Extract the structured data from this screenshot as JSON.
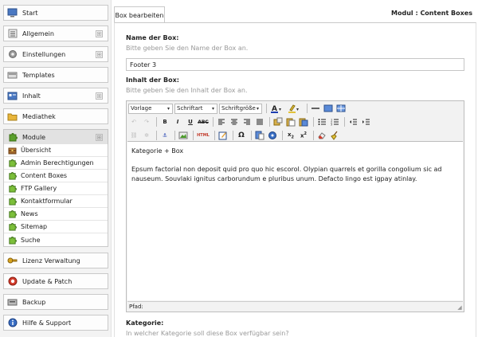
{
  "sidebar": {
    "items": [
      {
        "label": "Start",
        "icon": "monitor-icon",
        "expandable": false
      },
      {
        "label": "Allgemein",
        "icon": "list-icon",
        "expandable": true
      },
      {
        "label": "Einstellungen",
        "icon": "gear-icon",
        "expandable": true
      },
      {
        "label": "Templates",
        "icon": "template-icon",
        "expandable": false
      },
      {
        "label": "Inhalt",
        "icon": "content-icon",
        "expandable": true
      },
      {
        "label": "Mediathek",
        "icon": "folder-icon",
        "expandable": false
      },
      {
        "label": "Module",
        "icon": "puzzle-icon",
        "expandable": true
      },
      {
        "label": "Lizenz Verwaltung",
        "icon": "key-icon",
        "expandable": false
      },
      {
        "label": "Update & Patch",
        "icon": "update-icon",
        "expandable": false
      },
      {
        "label": "Backup",
        "icon": "backup-icon",
        "expandable": false
      },
      {
        "label": "Hilfe & Support",
        "icon": "help-icon",
        "expandable": false
      }
    ],
    "expand_symbol": "⊞",
    "module_sub": [
      {
        "label": "Übersicht",
        "icon": "chest-icon"
      },
      {
        "label": "Admin Berechtigungen",
        "icon": "puzzle-icon"
      },
      {
        "label": "Content Boxes",
        "icon": "puzzle-icon"
      },
      {
        "label": "FTP Gallery",
        "icon": "puzzle-icon"
      },
      {
        "label": "Kontaktformular",
        "icon": "puzzle-icon"
      },
      {
        "label": "News",
        "icon": "puzzle-icon"
      },
      {
        "label": "Sitemap",
        "icon": "puzzle-icon"
      },
      {
        "label": "Suche",
        "icon": "puzzle-icon"
      }
    ]
  },
  "main": {
    "tab_label": "Box bearbeiten",
    "module_title": "Modul : Content Boxes",
    "name_label": "Name der Box:",
    "name_hint": "Bitte geben Sie den Name der Box an.",
    "name_value": "Footer 3",
    "content_label": "Inhalt der Box:",
    "content_hint": "Bitte geben Sie den Inhalt der Box an.",
    "category_label": "Kategorie:",
    "category_hint": "In welcher Kategorie soll diese Box verfügbar sein?"
  },
  "editor": {
    "format_select": "Vorlage",
    "font_select": "Schriftart",
    "size_select": "Schriftgröße",
    "content_heading": "Kategorie + Box",
    "content_body": "Epsum factorial non deposit quid pro quo hic escorol. Olypian quarrels et gorilla congolium sic ad nauseum. Souvlaki ignitus carborundum e pluribus unum. Defacto lingo est igpay atinlay.",
    "status_path": "Pfad:"
  },
  "colors": {
    "accent_puzzle": "#5aa02c",
    "folder": "#e8b53a",
    "key": "#d9a520",
    "update": "#d23c2c",
    "help": "#3a6fc4"
  }
}
